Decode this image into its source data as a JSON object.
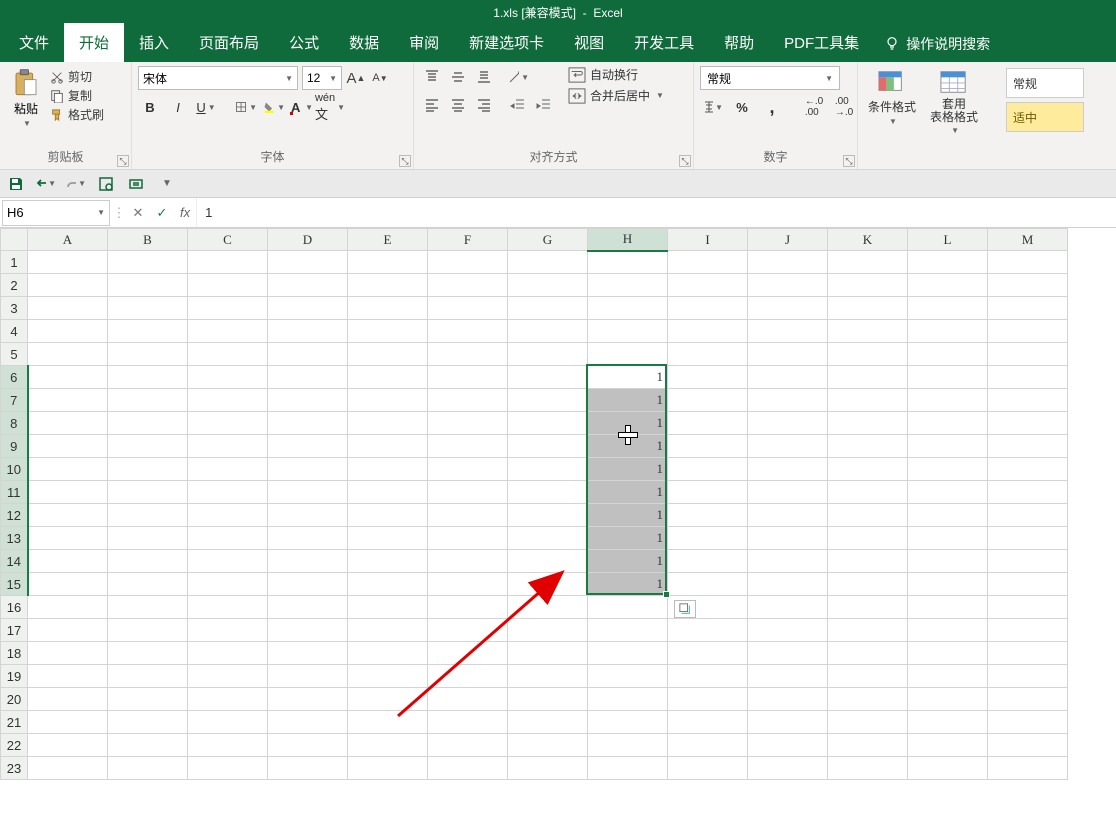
{
  "title_bar": {
    "filename": "1.xls",
    "compat": "[兼容模式]",
    "sep": "-",
    "app": "Excel"
  },
  "tabs": {
    "file": "文件",
    "home": "开始",
    "insert": "插入",
    "page_layout": "页面布局",
    "formulas": "公式",
    "data": "数据",
    "review": "审阅",
    "new_tab": "新建选项卡",
    "view": "视图",
    "developer": "开发工具",
    "help": "帮助",
    "pdf": "PDF工具集",
    "tell_me": "操作说明搜索"
  },
  "ribbon": {
    "clipboard": {
      "paste": "粘贴",
      "cut": "剪切",
      "copy": "复制",
      "format_painter": "格式刷",
      "label": "剪贴板"
    },
    "font": {
      "name": "宋体",
      "size": "12",
      "label": "字体"
    },
    "alignment": {
      "wrap": "自动换行",
      "merge": "合并后居中",
      "label": "对齐方式"
    },
    "number": {
      "format": "常规",
      "label": "数字"
    },
    "styles": {
      "cond_format": "条件格式",
      "table_format": "套用\n表格格式",
      "normal": "常规",
      "good": "适中"
    }
  },
  "formula_bar": {
    "name_box": "H6",
    "fx": "fx",
    "value": "1"
  },
  "grid": {
    "columns": [
      "A",
      "B",
      "C",
      "D",
      "E",
      "F",
      "G",
      "H",
      "I",
      "J",
      "K",
      "L",
      "M"
    ],
    "rows": [
      "1",
      "2",
      "3",
      "4",
      "5",
      "6",
      "7",
      "8",
      "9",
      "10",
      "11",
      "12",
      "13",
      "14",
      "15",
      "16",
      "17",
      "18",
      "19",
      "20",
      "21",
      "22",
      "23"
    ],
    "selected_col": "H",
    "selected_rows_start": 6,
    "selected_rows_end": 15,
    "data": {
      "H6": "1",
      "H7": "1",
      "H8": "1",
      "H9": "1",
      "H10": "1",
      "H11": "1",
      "H12": "1",
      "H13": "1",
      "H14": "1",
      "H15": "1"
    }
  }
}
